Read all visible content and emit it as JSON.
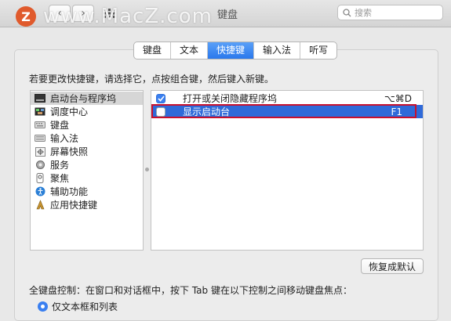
{
  "window": {
    "title": "键盘",
    "search_placeholder": "搜索",
    "watermark_logo": "Z",
    "watermark_text": "www.MacZ.com"
  },
  "tabs": [
    {
      "label": "键盘",
      "active": false
    },
    {
      "label": "文本",
      "active": false
    },
    {
      "label": "快捷键",
      "active": true
    },
    {
      "label": "输入法",
      "active": false
    },
    {
      "label": "听写",
      "active": false
    }
  ],
  "instruction": "若要更改快捷键，请选择它，点按组合键，然后键入新键。",
  "categories": [
    {
      "label": "启动台与程序坞",
      "icon": "launchpad-dock-icon",
      "selected": true
    },
    {
      "label": "调度中心",
      "icon": "mission-control-icon",
      "selected": false
    },
    {
      "label": "键盘",
      "icon": "keyboard-icon",
      "selected": false
    },
    {
      "label": "输入法",
      "icon": "input-method-icon",
      "selected": false
    },
    {
      "label": "屏幕快照",
      "icon": "screenshot-icon",
      "selected": false
    },
    {
      "label": "服务",
      "icon": "services-gear-icon",
      "selected": false
    },
    {
      "label": "聚焦",
      "icon": "spotlight-icon",
      "selected": false
    },
    {
      "label": "辅助功能",
      "icon": "accessibility-icon",
      "selected": false
    },
    {
      "label": "应用快捷键",
      "icon": "app-shortcuts-icon",
      "selected": false
    }
  ],
  "shortcuts": [
    {
      "label": "打开或关闭隐藏程序坞",
      "key": "⌥⌘D",
      "checked": true,
      "selected": false
    },
    {
      "label": "显示启动台",
      "key": "F1",
      "checked": false,
      "selected": true
    }
  ],
  "restore_button": "恢复成默认",
  "keyboard_control_label": "全键盘控制：在窗口和对话框中，按下 Tab 键在以下控制之间移动键盘焦点：",
  "radio_option": "仅文本框和列表",
  "colors": {
    "accent": "#2f6ad9",
    "highlight_border": "#c8102e"
  }
}
